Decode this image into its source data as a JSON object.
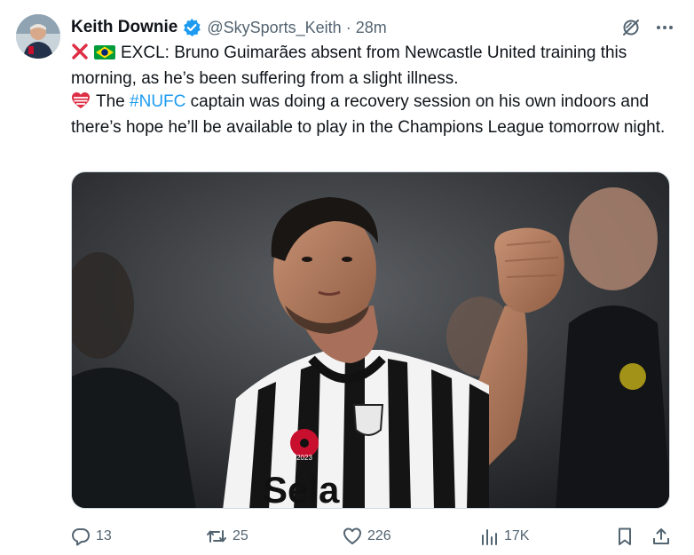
{
  "author": {
    "name": "Keith Downie",
    "handle": "@SkySports_Keith",
    "separator": "·",
    "time": "28m"
  },
  "tweet": {
    "line1_text": "EXCL: Bruno Guimarães absent from Newcastle United training this morning, as he’s been suffering from a slight illness.",
    "line2_pre": "The ",
    "hashtag": "#NUFC",
    "line2_post": " captain was doing a recovery session on his own indoors and there’s hope he’ll be available to play in the Champions League tomorrow night."
  },
  "media": {
    "kit_text": "Sela",
    "poppy_text": "2023"
  },
  "actions": {
    "replies": "13",
    "reposts": "25",
    "likes": "226",
    "views": "17K"
  },
  "icons": {
    "header": [
      "verified-badge-icon",
      "grok-icon",
      "more-icon"
    ],
    "emoji": [
      "cross-mark-icon",
      "brazil-flag-icon",
      "heart-emoji-icon"
    ],
    "actions": [
      "reply-icon",
      "repost-icon",
      "like-icon",
      "views-icon",
      "bookmark-icon",
      "share-icon"
    ]
  },
  "colors": {
    "text": "#0f1419",
    "secondary": "#536471",
    "accent": "#1d9bf0"
  }
}
